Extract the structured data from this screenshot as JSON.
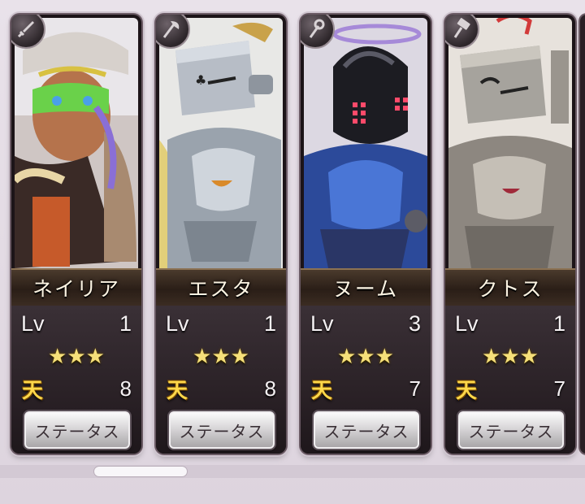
{
  "cards": [
    {
      "name": "ネイリア",
      "weapon_icon": "sword-icon",
      "level_label": "Lv",
      "level": "1",
      "stars": "★★★",
      "rank_icon_text": "天",
      "rank_value": "8",
      "button_label": "ステータス"
    },
    {
      "name": "エスタ",
      "weapon_icon": "axe-icon",
      "level_label": "Lv",
      "level": "1",
      "stars": "★★★",
      "rank_icon_text": "天",
      "rank_value": "8",
      "button_label": "ステータス"
    },
    {
      "name": "ヌーム",
      "weapon_icon": "staff-icon",
      "level_label": "Lv",
      "level": "3",
      "stars": "★★★",
      "rank_icon_text": "天",
      "rank_value": "7",
      "button_label": "ステータス"
    },
    {
      "name": "クトス",
      "weapon_icon": "hammer-icon",
      "level_label": "Lv",
      "level": "1",
      "stars": "★★★",
      "rank_icon_text": "天",
      "rank_value": "7",
      "button_label": "ステータス"
    }
  ],
  "colors": {
    "star": "#f6e07a",
    "rank": "#ffd84a",
    "name_text": "#fbf3e2"
  }
}
